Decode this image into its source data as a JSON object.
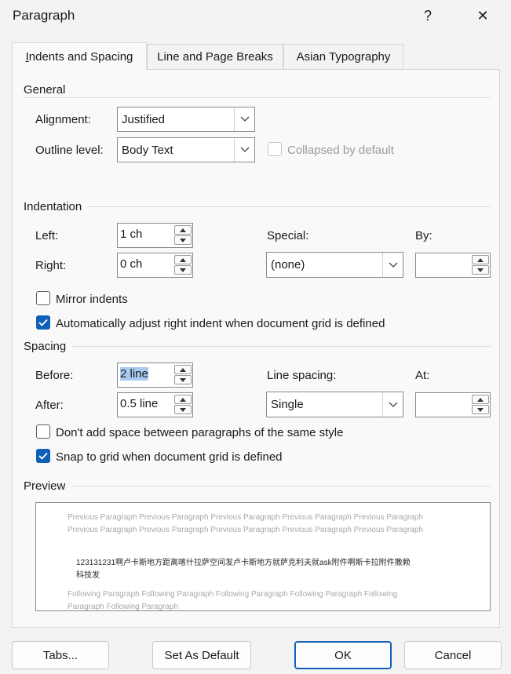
{
  "window": {
    "title": "Paragraph",
    "help": "?",
    "close": "✕"
  },
  "tabs": [
    {
      "label": "Indents and Spacing",
      "active": true
    },
    {
      "label": "Line and Page Breaks",
      "active": false
    },
    {
      "label": "Asian Typography",
      "active": false
    }
  ],
  "general": {
    "section_label": "General",
    "alignment_label": "Alignment:",
    "alignment_value": "Justified",
    "outline_label": "Outline level:",
    "outline_value": "Body Text",
    "collapsed_label": "Collapsed by default",
    "collapsed_checked": false
  },
  "indentation": {
    "section_label": "Indentation",
    "left_label": "Left:",
    "left_value": "1 ch",
    "right_label": "Right:",
    "right_value": "0 ch",
    "special_label": "Special:",
    "special_value": "(none)",
    "by_label": "By:",
    "by_value": "",
    "mirror_label": "Mirror indents",
    "mirror_checked": false,
    "auto_adjust_label": "Automatically adjust right indent when document grid is defined",
    "auto_adjust_checked": true
  },
  "spacing": {
    "section_label": "Spacing",
    "before_label": "Before:",
    "before_value": "2 line",
    "after_label": "After:",
    "after_value": "0.5 line",
    "line_spacing_label": "Line spacing:",
    "line_spacing_value": "Single",
    "at_label": "At:",
    "at_value": "",
    "dont_add_label": "Don't add space between paragraphs of the same style",
    "dont_add_checked": false,
    "snap_label": "Snap to grid when document grid is defined",
    "snap_checked": true
  },
  "preview": {
    "section_label": "Preview",
    "previous_line1": "Previous Paragraph Previous Paragraph Previous Paragraph Previous Paragraph Previous Paragraph",
    "previous_line2": "Previous Paragraph Previous Paragraph Previous Paragraph Previous Paragraph Previous Paragraph",
    "main_line1": "123131231啊卢卡斯地方距离喀什拉萨空间发卢卡斯地方就萨克利夫就ask附件啊斯卡拉附件撒赖",
    "main_line2": "科技发",
    "following_line1": "Following Paragraph Following Paragraph Following Paragraph Following Paragraph Following",
    "following_line2": "Paragraph Following Paragraph"
  },
  "buttons": {
    "tabs": "Tabs...",
    "set_default": "Set As Default",
    "ok": "OK",
    "cancel": "Cancel"
  }
}
